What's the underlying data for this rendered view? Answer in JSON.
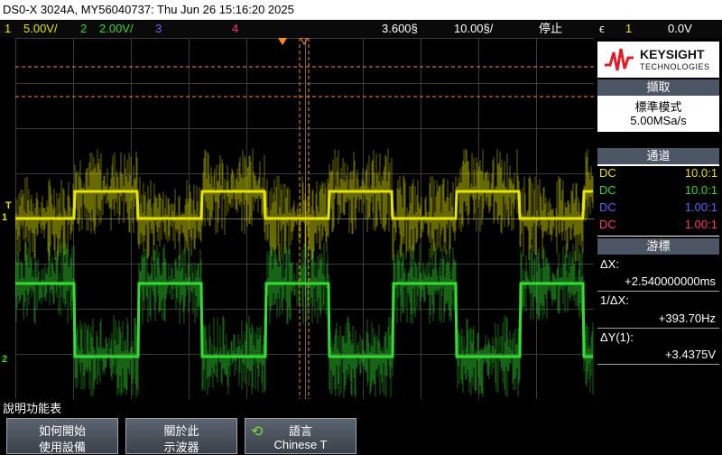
{
  "title_bar": "DS0-X 3024A, MY56040737: Thu Jun 26 15:16:20 2025",
  "status_bar": {
    "ch1_num": "1",
    "ch1_scale": "5.00V/",
    "ch2_num": "2",
    "ch2_scale": "2.00V/",
    "ch3_num": "3",
    "ch4_num": "4",
    "time_offset": "3.600§",
    "time_scale": "10.00§/",
    "run_state": "停止",
    "trigger_icon": "ᶜ",
    "trigger_source": "1",
    "trigger_level": "0.0V"
  },
  "logo": {
    "brand": "KEYSIGHT",
    "sub": "TECHNOLOGIES"
  },
  "acquire": {
    "header": "擷取",
    "mode": "標準模式",
    "rate": "5.00MSa/s"
  },
  "channels": {
    "header": "通道",
    "rows": [
      {
        "coupling": "DC",
        "probe": "10.0:1"
      },
      {
        "coupling": "DC",
        "probe": "10.0:1"
      },
      {
        "coupling": "DC",
        "probe": "1.00:1"
      },
      {
        "coupling": "DC",
        "probe": "1.00:1"
      }
    ]
  },
  "cursors": {
    "header": "游標",
    "dx_label": "ΔX:",
    "dx_value": "+2.540000000ms",
    "inv_label": "1/ΔX:",
    "inv_value": "+393.70Hz",
    "dy_label": "ΔY(1):",
    "dy_value": "+3.4375V"
  },
  "ground_markers": {
    "ch1": "1",
    "ch2": "2",
    "trig": "T"
  },
  "menu": {
    "title": "說明功能表",
    "key1_l1": "如何開始",
    "key1_l2": "使用設備",
    "key2_l1": "關於此",
    "key2_l2": "示波器",
    "key3_l1": "語言",
    "key3_l2": "Chinese T"
  },
  "colors": {
    "ch1": "#e6e600",
    "ch2": "#33dd33",
    "ch3": "#5a64ff",
    "ch4": "#ff3b6b",
    "cursor": "#ff8c1a"
  }
}
